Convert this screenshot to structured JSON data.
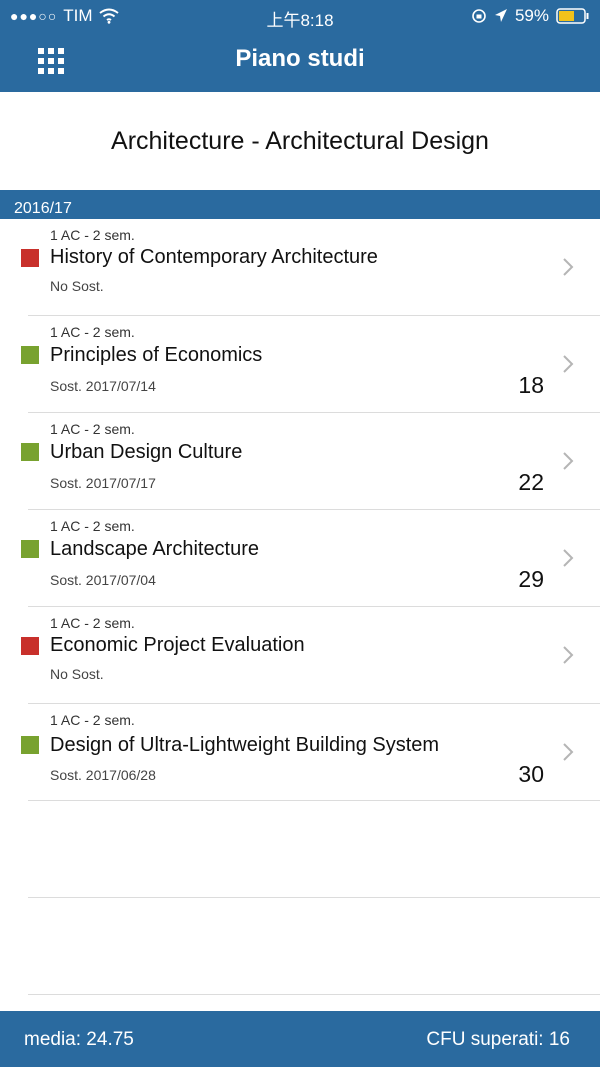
{
  "status_bar": {
    "carrier": "TIM",
    "signal": "●●●○○",
    "time": "上午8:18",
    "battery": "59%"
  },
  "header": {
    "title": "Piano studi",
    "menu_icon": "grid-icon"
  },
  "course": "Architecture - Architectural Design",
  "year": "2016/17",
  "exams": [
    {
      "sem": "1 AC -  2 sem.",
      "name": "History of Contemporary Architecture",
      "sost": "No Sost.",
      "grade": "",
      "status": "failed",
      "color": "#c8302b"
    },
    {
      "sem": "1 AC -  2 sem.",
      "name": "Principles of Economics",
      "sost": "Sost. 2017/07/14",
      "grade": "18",
      "status": "passed",
      "color": "#78a22f"
    },
    {
      "sem": "1 AC -  2 sem.",
      "name": "Urban Design Culture",
      "sost": "Sost. 2017/07/17",
      "grade": "22",
      "status": "passed",
      "color": "#78a22f"
    },
    {
      "sem": "1 AC -  2 sem.",
      "name": "Landscape Architecture",
      "sost": "Sost. 2017/07/04",
      "grade": "29",
      "status": "passed",
      "color": "#78a22f"
    },
    {
      "sem": "1 AC -  2 sem.",
      "name": "Economic Project Evaluation",
      "sost": "No Sost.",
      "grade": "",
      "status": "failed",
      "color": "#c8302b"
    },
    {
      "sem": "1 AC -  2 sem.",
      "name": "Design of Ultra-Lightweight Building System",
      "sost": "Sost. 2017/06/28",
      "grade": "30",
      "status": "passed",
      "color": "#78a22f"
    }
  ],
  "footer": {
    "media": "media: 24.75",
    "cfu": "CFU superati: 16"
  },
  "colors": {
    "brand": "#2a6a9f",
    "passed": "#78a22f",
    "failed": "#c8302b"
  }
}
